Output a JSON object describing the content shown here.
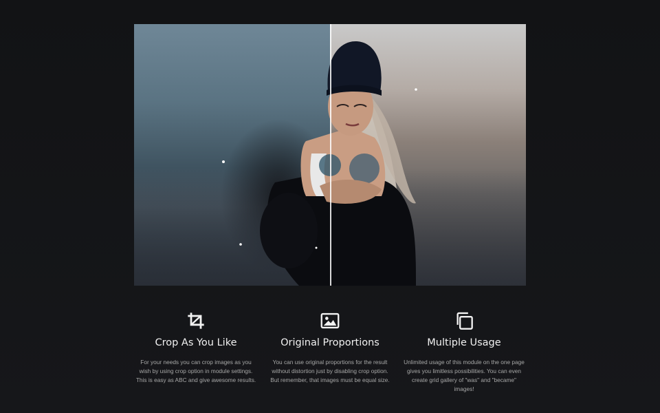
{
  "comparison": {
    "before_label": "before image",
    "after_label": "after image"
  },
  "features": [
    {
      "icon": "crop-icon",
      "title": "Crop As You Like",
      "text": "For your needs you can crop images as you wish by using crop option in module settings. This is easy as ABC and give awesome results."
    },
    {
      "icon": "image-icon",
      "title": "Original Proportions",
      "text": "You can use original proportions  for the result without distortion just by disabling crop option. But remember, that images must be equal size."
    },
    {
      "icon": "copy-icon",
      "title": "Multiple Usage",
      "text": "Unlimited usage of this module on the one page gives you limitless possibilities. You can even create grid gallery of \"was\" and \"became\" images!"
    }
  ]
}
